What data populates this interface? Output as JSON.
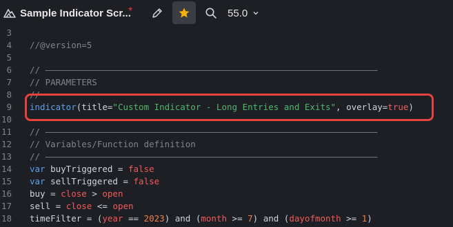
{
  "toolbar": {
    "title": "Sample Indicator Scr...",
    "unsaved_marker": "*",
    "zoom_label": "55.0"
  },
  "lines": [
    {
      "n": "3",
      "tokens": []
    },
    {
      "n": "4",
      "tokens": [
        {
          "t": "//@version=5",
          "c": "c-comment"
        }
      ]
    },
    {
      "n": "5",
      "tokens": []
    },
    {
      "n": "6",
      "tokens": [
        {
          "t": "// ————————————————————————————————————————————————————————————————",
          "c": "c-comment"
        }
      ]
    },
    {
      "n": "7",
      "tokens": [
        {
          "t": "// PARAMETERS",
          "c": "c-comment"
        }
      ]
    },
    {
      "n": "8",
      "tokens": [
        {
          "t": "//",
          "c": "c-comment"
        }
      ]
    },
    {
      "n": "9",
      "tokens": [
        {
          "t": "indicator",
          "c": "c-fn"
        },
        {
          "t": "(title=",
          "c": "c-plain"
        },
        {
          "t": "\"Custom Indicator - Long Entries and Exits\"",
          "c": "c-str"
        },
        {
          "t": ", overlay=",
          "c": "c-plain"
        },
        {
          "t": "true",
          "c": "c-kw"
        },
        {
          "t": ")",
          "c": "c-plain"
        }
      ]
    },
    {
      "n": "10",
      "tokens": []
    },
    {
      "n": "11",
      "tokens": [
        {
          "t": "// ————————————————————————————————————————————————————————————————",
          "c": "c-comment"
        }
      ]
    },
    {
      "n": "12",
      "tokens": [
        {
          "t": "// Variables/Function definition",
          "c": "c-comment"
        }
      ]
    },
    {
      "n": "13",
      "tokens": [
        {
          "t": "// ————————————————————————————————————————————————————————————————",
          "c": "c-comment"
        }
      ]
    },
    {
      "n": "14",
      "tokens": [
        {
          "t": "var",
          "c": "c-fn"
        },
        {
          "t": " buyTriggered = ",
          "c": "c-plain"
        },
        {
          "t": "false",
          "c": "c-kw"
        }
      ]
    },
    {
      "n": "15",
      "tokens": [
        {
          "t": "var",
          "c": "c-fn"
        },
        {
          "t": " sellTriggered = ",
          "c": "c-plain"
        },
        {
          "t": "false",
          "c": "c-kw"
        }
      ]
    },
    {
      "n": "16",
      "tokens": [
        {
          "t": "buy = ",
          "c": "c-plain"
        },
        {
          "t": "close",
          "c": "c-kw"
        },
        {
          "t": " > ",
          "c": "c-plain"
        },
        {
          "t": "open",
          "c": "c-kw"
        }
      ]
    },
    {
      "n": "17",
      "tokens": [
        {
          "t": "sell = ",
          "c": "c-plain"
        },
        {
          "t": "close",
          "c": "c-kw"
        },
        {
          "t": " <= ",
          "c": "c-plain"
        },
        {
          "t": "open",
          "c": "c-kw"
        }
      ]
    },
    {
      "n": "18",
      "tokens": [
        {
          "t": "timeFilter = (",
          "c": "c-plain"
        },
        {
          "t": "year",
          "c": "c-kw"
        },
        {
          "t": " == ",
          "c": "c-plain"
        },
        {
          "t": "2023",
          "c": "c-num"
        },
        {
          "t": ") and (",
          "c": "c-plain"
        },
        {
          "t": "month",
          "c": "c-kw"
        },
        {
          "t": " >= ",
          "c": "c-plain"
        },
        {
          "t": "7",
          "c": "c-num"
        },
        {
          "t": ") and (",
          "c": "c-plain"
        },
        {
          "t": "dayofmonth",
          "c": "c-kw"
        },
        {
          "t": " >= ",
          "c": "c-plain"
        },
        {
          "t": "1",
          "c": "c-num"
        },
        {
          "t": ")",
          "c": "c-plain"
        }
      ]
    }
  ],
  "colors": {
    "background": "#1e1f24",
    "highlight_border": "#e8423f",
    "star": "#f5b400"
  }
}
